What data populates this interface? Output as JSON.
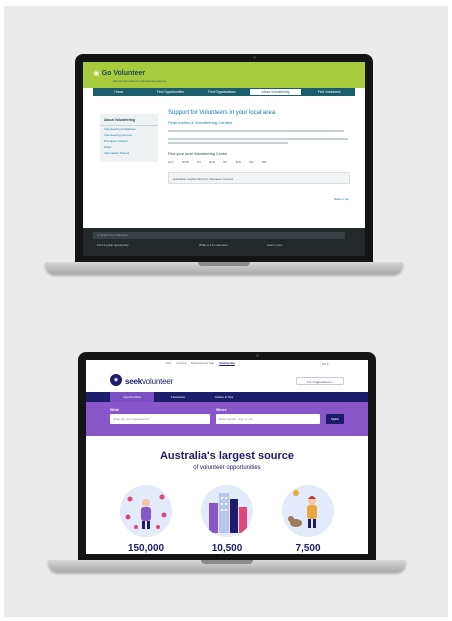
{
  "colors": {
    "panel_bg": "#ebebeb",
    "volunteering_green": "#a8ca3d",
    "volunteering_teal": "#1a5e6e",
    "seek_navy": "#1c1c6b",
    "seek_purple": "#8856c9"
  },
  "laptop1": {
    "logo_mark": "❀",
    "logo_text": "Go Volunteer",
    "tagline": "We are the nation's volunteering agency",
    "nav": [
      "Home",
      "Find Opportunities",
      "Find Organisations",
      "About Volunteering",
      "Find Volunteers"
    ],
    "sidebar": {
      "heading": "About Volunteering",
      "links": [
        "Volunteering Guidelines",
        "Volunteering Centres",
        "Principles Charter",
        "FAQs",
        "Information Sheets"
      ]
    },
    "page_title": "Support for Volunteers in your local area",
    "page_subtitle": "Peak bodies & Volunteering Centres",
    "find_heading": "Find your local Volunteering Centre",
    "states": [
      "ACT",
      "NSW",
      "NT",
      "QLD",
      "SA",
      "TAS",
      "VIC",
      "WA"
    ],
    "box_text": "Australian Capital Territory Volunteer Centres",
    "back_to_top": "Back to top",
    "footer_search": "Q  Search Go Volunteer",
    "footer_links": [
      "Find a great opportunity",
      "What is it to volunteer",
      "Learn more"
    ]
  },
  "laptop2": {
    "top_links": [
      "Jobs",
      "Courses",
      "Businesses for Sale",
      "Volunteering"
    ],
    "flag": "AU ▾",
    "logo_glyph": "◉",
    "logo_bold": "seek",
    "logo_light": "volunteer",
    "employer_button": "For Organisations ›",
    "nav_tabs": [
      "Opportunities",
      "Favourites",
      "Advice & Tips"
    ],
    "what_label": "What",
    "what_placeholder": "What are you interested in?",
    "where_label": "Where",
    "where_placeholder": "Enter suburb, town or city",
    "search_button": "SEEK",
    "headline": "Australia's largest source",
    "subheadline": "of volunteer opportunities",
    "stats": [
      "150,000",
      "10,500",
      "7,500"
    ]
  }
}
